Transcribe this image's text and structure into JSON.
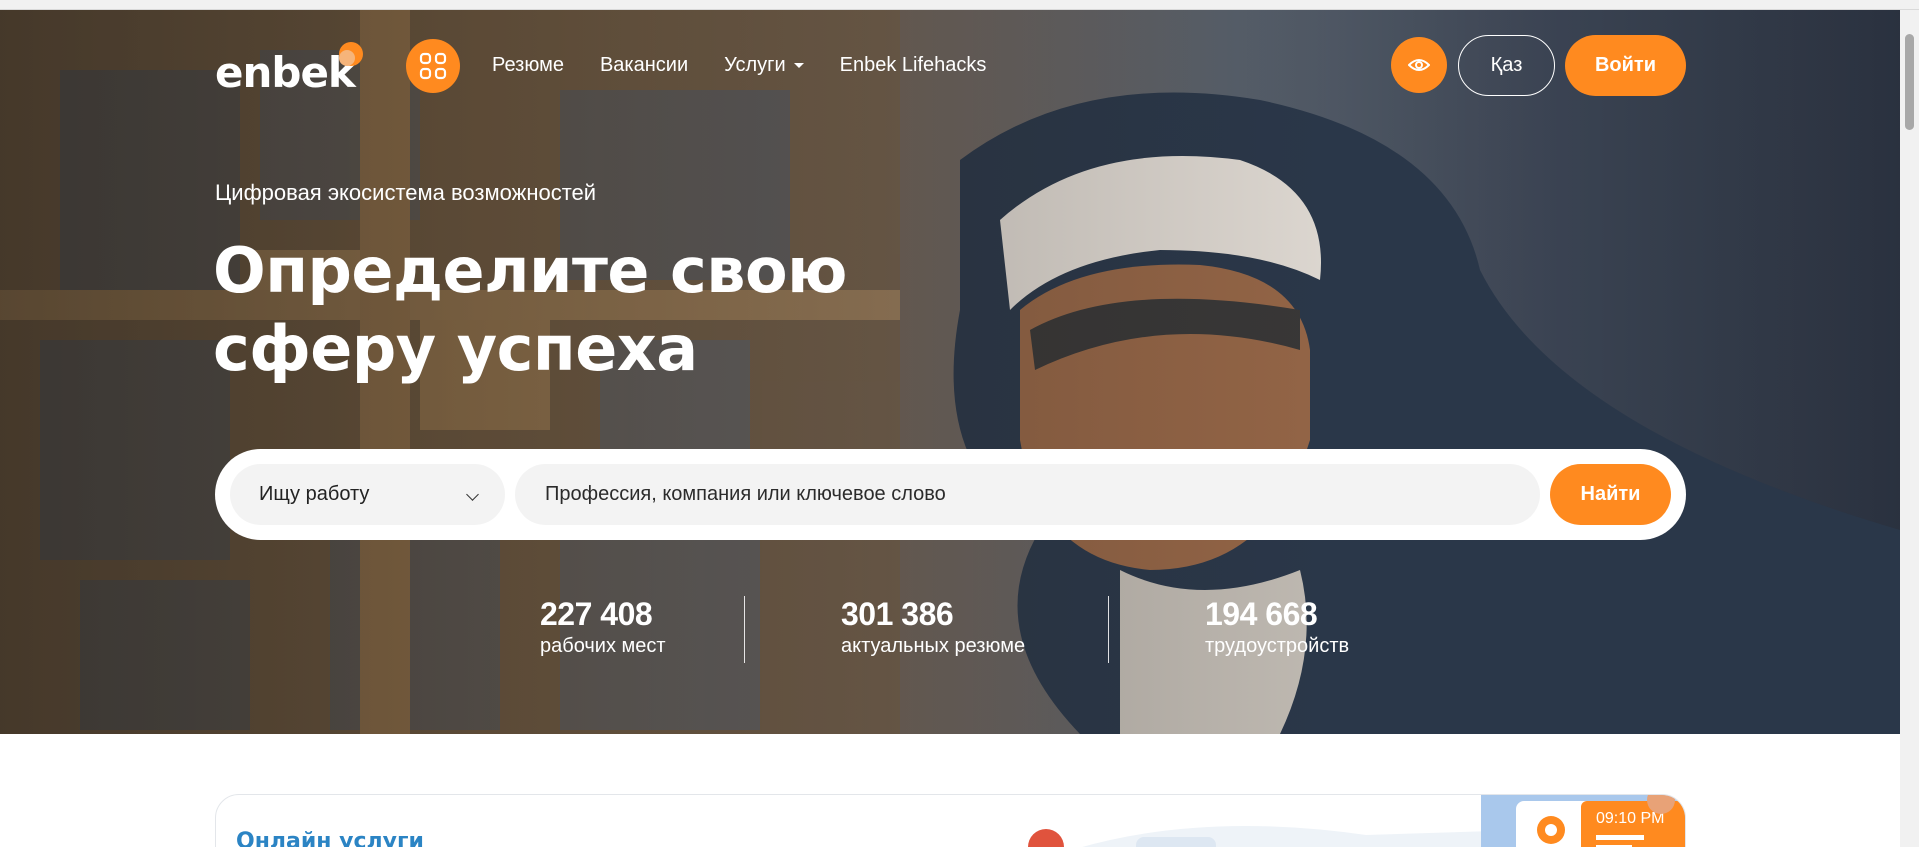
{
  "header": {
    "logo_text": "enbek",
    "nav": [
      {
        "label": "Резюме",
        "has_dropdown": false
      },
      {
        "label": "Вакансии",
        "has_dropdown": false
      },
      {
        "label": "Услуги",
        "has_dropdown": true
      },
      {
        "label": "Enbek Lifehacks",
        "has_dropdown": false
      }
    ],
    "lang_label": "Қаз",
    "login_label": "Войти"
  },
  "hero": {
    "subtitle": "Цифровая экосистема возможностей",
    "headline_line1": "Определите свою",
    "headline_line2": "сферу успеха"
  },
  "search": {
    "mode_selected": "Ищу работу",
    "placeholder": "Профессия, компания или ключевое слово",
    "button_label": "Найти"
  },
  "stats": [
    {
      "value": "227 408",
      "label": "рабочих мест"
    },
    {
      "value": "301 386",
      "label": "актуальных резюме"
    },
    {
      "value": "194 668",
      "label": "трудоустройств"
    }
  ],
  "services": {
    "title": "Онлайн услуги",
    "illustration_time": "09:10 PM"
  },
  "colors": {
    "accent": "#ff8a1f",
    "services_title": "#2b84c4"
  },
  "icons": {
    "apps": "grid-icon",
    "accessibility": "eye-icon",
    "select_chevron": "chevron-down-icon"
  }
}
